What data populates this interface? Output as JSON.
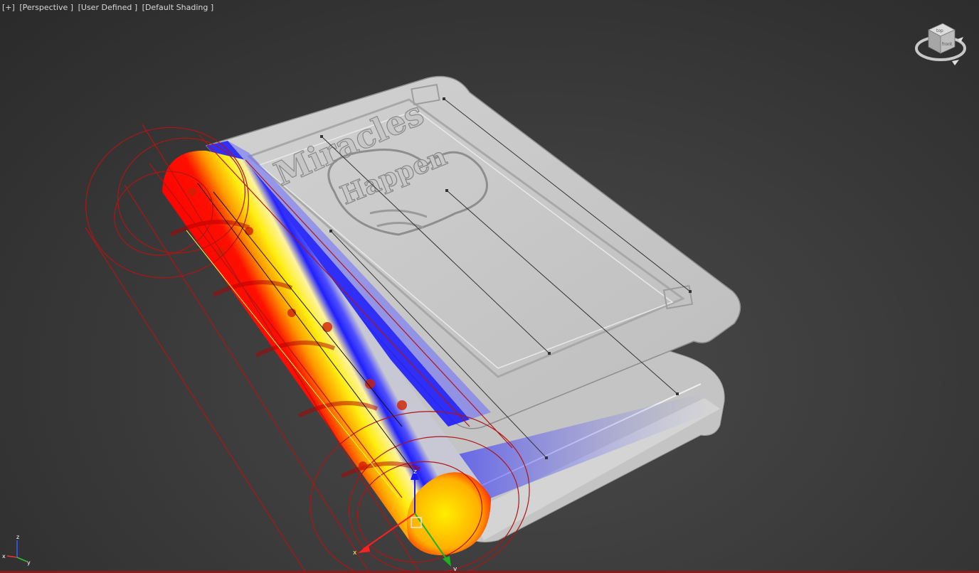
{
  "viewport": {
    "labels": {
      "menu": "[+]",
      "view": "[Perspective ]",
      "display": "[User Defined ]",
      "shading": "[Default Shading ]"
    }
  },
  "book": {
    "cover_title": "Miracles",
    "cover_subtitle": "Happen"
  },
  "gizmo": {
    "x": "x",
    "y": "y",
    "z": "z"
  },
  "axis_tripod": {
    "x": "x",
    "y": "y",
    "z": "z"
  },
  "view_cube": {
    "face_top": "top",
    "face_front": "front"
  },
  "colors": {
    "background": "#3a3a3a",
    "book_surface": "#c9c9c9",
    "weight_red": "#ff0000",
    "weight_yellow": "#ffee00",
    "weight_blue": "#1010ff",
    "spline_red": "#b01414"
  }
}
